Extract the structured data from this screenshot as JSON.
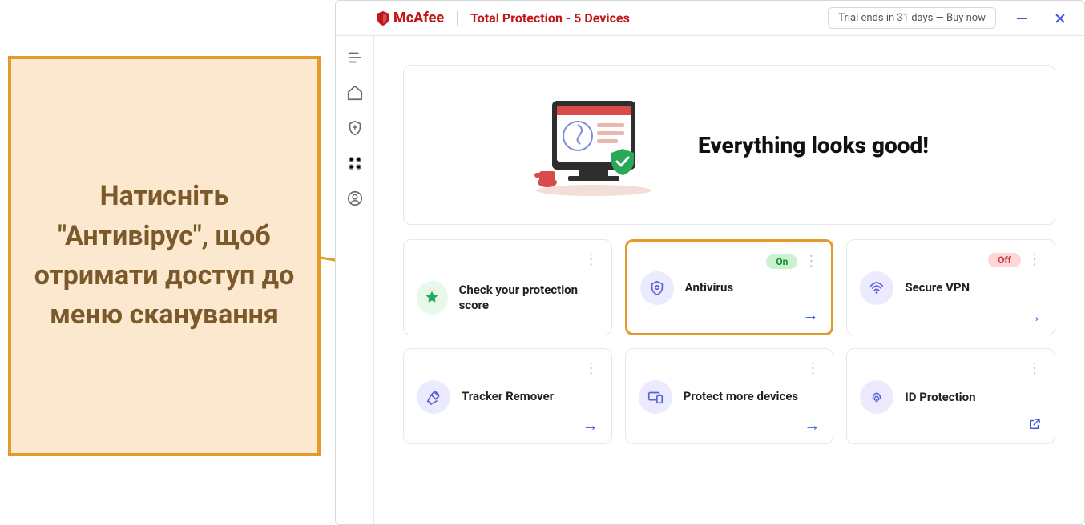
{
  "brand": {
    "name": "McAfee",
    "product": "Total Protection - 5 Devices"
  },
  "trial": "Trial ends in 31 days — Buy now",
  "hero": {
    "headline": "Everything looks good!"
  },
  "cards": {
    "score": {
      "label": "Check your protection score"
    },
    "av": {
      "label": "Antivirus",
      "status": "On"
    },
    "vpn": {
      "label": "Secure VPN",
      "status": "Off"
    },
    "tracker": {
      "label": "Tracker Remover"
    },
    "protect": {
      "label": "Protect more devices"
    },
    "idp": {
      "label": "ID Protection"
    }
  },
  "callout": "Натисніть \"Антивірус\", щоб отримати доступ до меню сканування"
}
